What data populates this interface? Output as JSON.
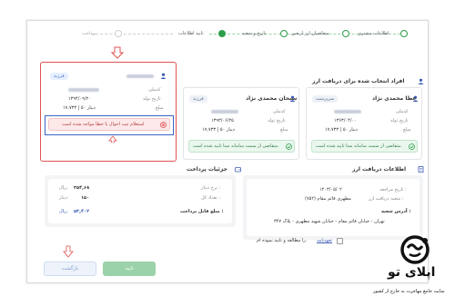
{
  "stepper": {
    "steps": [
      {
        "label": "اطلاعات مشتری",
        "state": "done"
      },
      {
        "label": "متقاضیان ارز اربعین",
        "state": "done"
      },
      {
        "label": "تاریخ و شعبه",
        "state": "done"
      },
      {
        "label": "تایید اطلاعات",
        "state": "active"
      },
      {
        "label": "پرداخت",
        "state": "pending"
      }
    ]
  },
  "selected_section": {
    "title": "افراد انتخاب شده برای دریافت ارز"
  },
  "applicants": [
    {
      "name": "عطا محمدی نژاد",
      "role": "سرپرست",
      "fields": [
        {
          "label": "کدملی",
          "value": ""
        },
        {
          "label": "تاریخ تولد",
          "value": "۱۳۶۳/۰۴/۰۰"
        },
        {
          "label": "مبلغ",
          "value": "۱۷,۷۳۳ | ۵۰ دینار"
        }
      ],
      "status_text": "متقاضی از سمت سامانه سنا تایید شده است.",
      "status": "ok"
    },
    {
      "name": "سبحان محمدی نژاد",
      "role": "فرزند",
      "fields": [
        {
          "label": "کدملی",
          "value": ""
        },
        {
          "label": "تاریخ تولد",
          "value": "۱۳۹۳/۰۶/۲۵"
        },
        {
          "label": "مبلغ",
          "value": "۱۷,۷۳۳ | ۵۰ دینار"
        }
      ],
      "status_text": "متقاضی از سمت سامانه سنا تایید شده است.",
      "status": "ok"
    },
    {
      "name": "",
      "role": "فرزند",
      "fields": [
        {
          "label": "کدملی",
          "value": ""
        },
        {
          "label": "تاریخ تولد",
          "value": "۱۳۹۴/۰۹/۲۰"
        },
        {
          "label": "مبلغ",
          "value": "۱۷,۷۳۳ | ۵۰ دینار"
        }
      ],
      "status_text": "استعلام ثبت احوال با خطا مواجه شده است",
      "status": "error"
    }
  ],
  "receive_info": {
    "title": "اطلاعات دریافت ارز",
    "rows": [
      {
        "label": "تاریخ مراجعه :",
        "value": "۱۴۰۳/۰۵/۰۲"
      },
      {
        "label": "شعبه دریافت ارز :",
        "value": "مطهری قائم مقام (۷۵۲)"
      }
    ],
    "address_label": "آدرس شعبه :",
    "address_value": "تهران - خیابان قائم مقام - خیابان شهید مطهری - پلاک ۳۴۷"
  },
  "payment": {
    "title": "جزئیات پرداخت",
    "rows": [
      {
        "label": "نرخ دینار :",
        "value": "۳۵۴,۶۸",
        "unit": "ریال"
      },
      {
        "label": "تعداد کل :",
        "value": "۱۵۰",
        "unit": "دینار"
      }
    ],
    "total_label": "مبلغ قابل پرداخت :",
    "total_value": "۵۳,۴۰۲",
    "total_unit": "ریال"
  },
  "agreement": {
    "link": "تعهدنامه",
    "text": "را مطالعه و تایید نموده ام."
  },
  "buttons": {
    "confirm": "تایید",
    "back": "بازگشت"
  },
  "watermark": {
    "brand": "اپلای تو",
    "tagline": "سایت جامع مهاجرت به خارج از کشور"
  },
  "colors": {
    "accent_green": "#2e9e4a",
    "error_red": "#e05252",
    "highlight_blue": "#3a63c9"
  }
}
